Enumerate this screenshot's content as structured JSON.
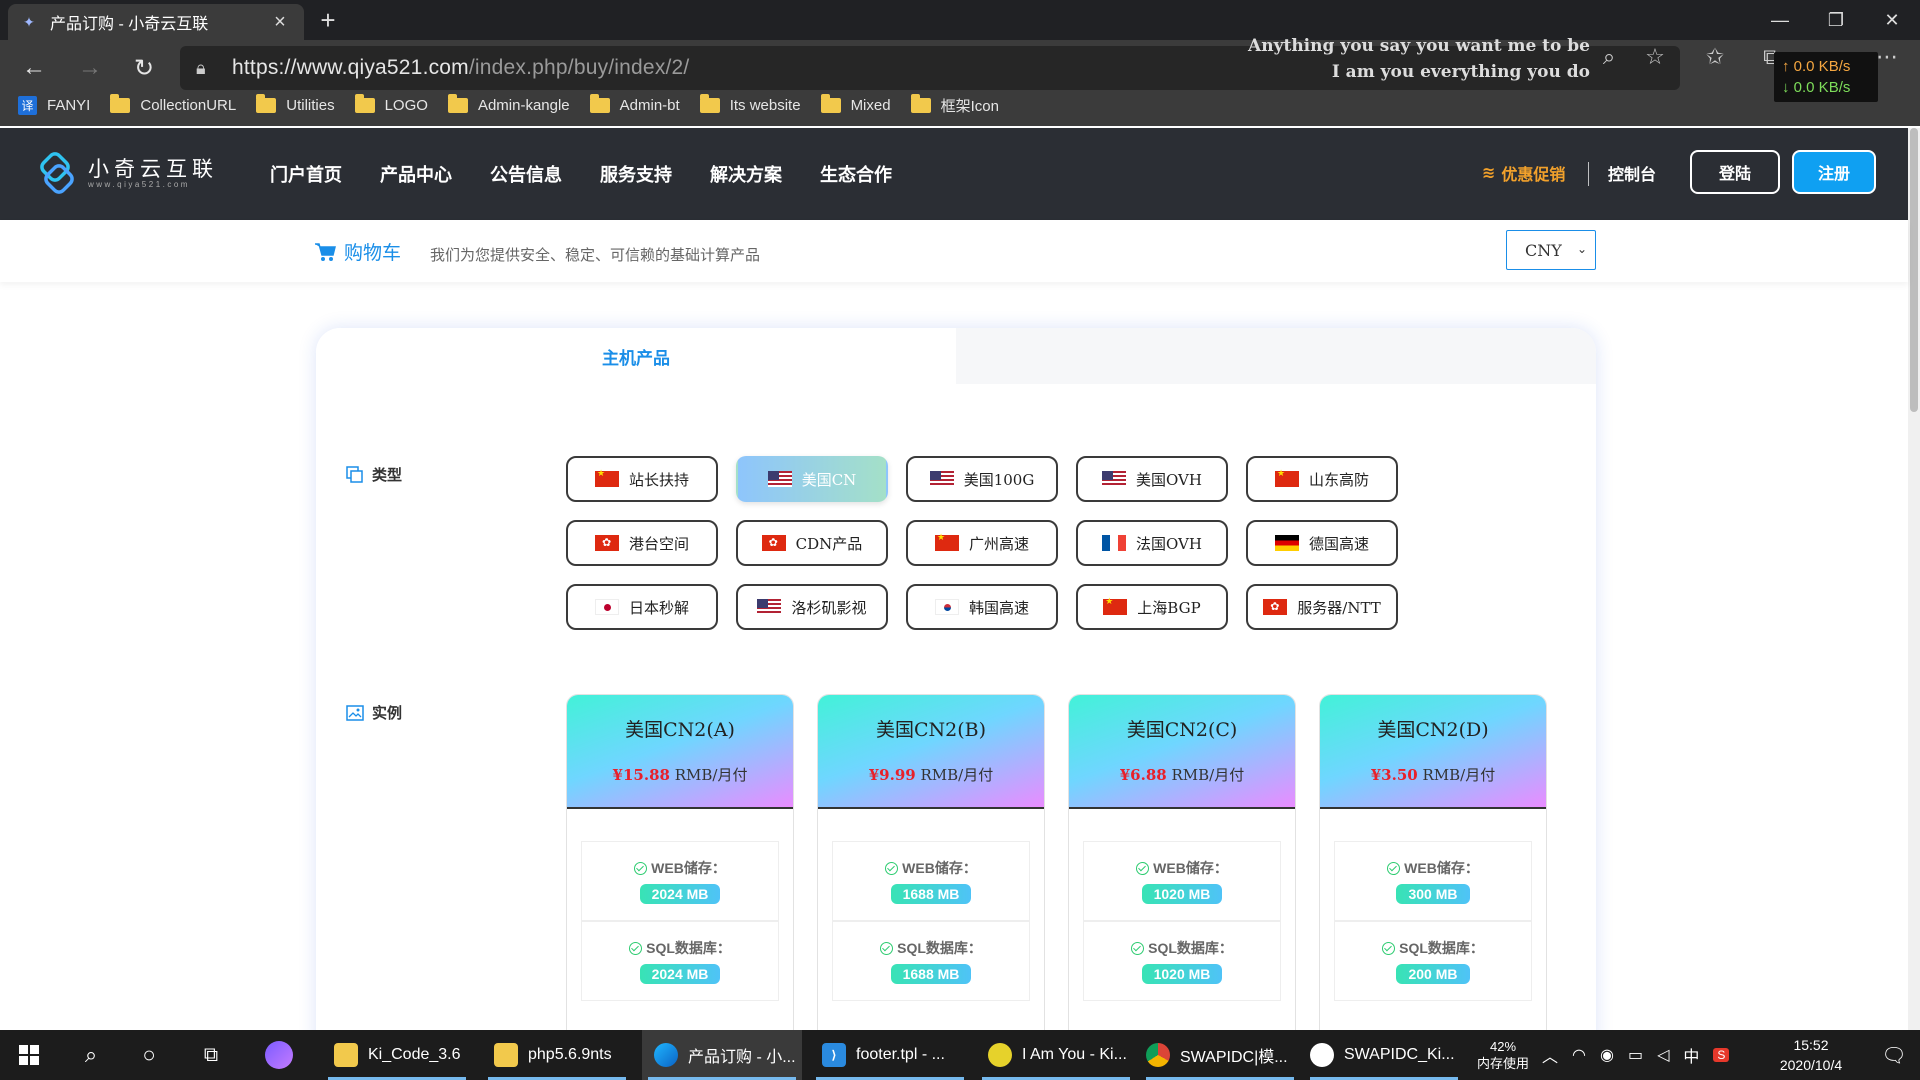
{
  "browser": {
    "tab_title": "产品订购 - 小奇云互联",
    "url_host": "https://www.qiya521.com",
    "url_path": "/index.php/buy/index/2/",
    "lyric_line1": "Anything you say you want me to be",
    "lyric_line2": "I am you everything you do",
    "net_up": "↑ 0.0 KB/s",
    "net_down": "↓ 0.0 KB/s",
    "bookmarks": [
      "FANYI",
      "CollectionURL",
      "Utilities",
      "LOGO",
      "Admin-kangle",
      "Admin-bt",
      "Its website",
      "Mixed",
      "框架Icon"
    ]
  },
  "site": {
    "logo_text": "小奇云互联",
    "logo_sub": "www.qiya521.com",
    "nav": [
      "门户首页",
      "产品中心",
      "公告信息",
      "服务支持",
      "解决方案",
      "生态合作"
    ],
    "promo": "优惠促销",
    "console": "控制台",
    "login": "登陆",
    "register": "注册",
    "accent_color": "#0fa0f2"
  },
  "cart": {
    "title": "购物车",
    "subtitle": "我们为您提供安全、稳定、可信赖的基础计算产品",
    "currency": "CNY"
  },
  "main": {
    "tab_label": "主机产品",
    "type_label": "类型",
    "instance_label": "实例",
    "types": [
      {
        "label": "站长扶持",
        "flag": "cn",
        "active": false
      },
      {
        "label": "美国CN",
        "flag": "us",
        "active": true
      },
      {
        "label": "美国100G",
        "flag": "us",
        "active": false
      },
      {
        "label": "美国OVH",
        "flag": "us",
        "active": false
      },
      {
        "label": "山东高防",
        "flag": "cn",
        "active": false
      },
      {
        "label": "港台空间",
        "flag": "hk",
        "active": false
      },
      {
        "label": "CDN产品",
        "flag": "hk",
        "active": false
      },
      {
        "label": "广州高速",
        "flag": "cn",
        "active": false
      },
      {
        "label": "法国OVH",
        "flag": "fr",
        "active": false
      },
      {
        "label": "德国高速",
        "flag": "de",
        "active": false
      },
      {
        "label": "日本秒解",
        "flag": "jp",
        "active": false
      },
      {
        "label": "洛杉矶影视",
        "flag": "us",
        "active": false
      },
      {
        "label": "韩国高速",
        "flag": "kr",
        "active": false
      },
      {
        "label": "上海BGP",
        "flag": "cn",
        "active": false
      },
      {
        "label": "服务器/NTT",
        "flag": "hk",
        "active": false
      }
    ],
    "plans": [
      {
        "name": "美国CN2(A)",
        "price": "¥15.88",
        "unit": " RMB/月付",
        "web_label": "WEB储存：",
        "web": "2024 MB",
        "sql_label": "SQL数据库：",
        "sql": "2024 MB"
      },
      {
        "name": "美国CN2(B)",
        "price": "¥9.99",
        "unit": " RMB/月付",
        "web_label": "WEB储存：",
        "web": "1688 MB",
        "sql_label": "SQL数据库：",
        "sql": "1688 MB"
      },
      {
        "name": "美国CN2(C)",
        "price": "¥6.88",
        "unit": " RMB/月付",
        "web_label": "WEB储存：",
        "web": "1020 MB",
        "sql_label": "SQL数据库：",
        "sql": "1020 MB"
      },
      {
        "name": "美国CN2(D)",
        "price": "¥3.50",
        "unit": " RMB/月付",
        "web_label": "WEB储存：",
        "web": "300 MB",
        "sql_label": "SQL数据库：",
        "sql": "200 MB"
      }
    ]
  },
  "taskbar": {
    "apps": [
      "Ki_Code_3.6",
      "php5.6.9nts",
      "产品订购 - 小...",
      "footer.tpl - ...",
      "I Am You - Ki...",
      "SWAPIDC|模...",
      "SWAPIDC_Ki..."
    ],
    "mem_percent": "42%",
    "mem_label": "内存使用",
    "ime": "中",
    "time": "15:52",
    "date": "2020/10/4"
  }
}
